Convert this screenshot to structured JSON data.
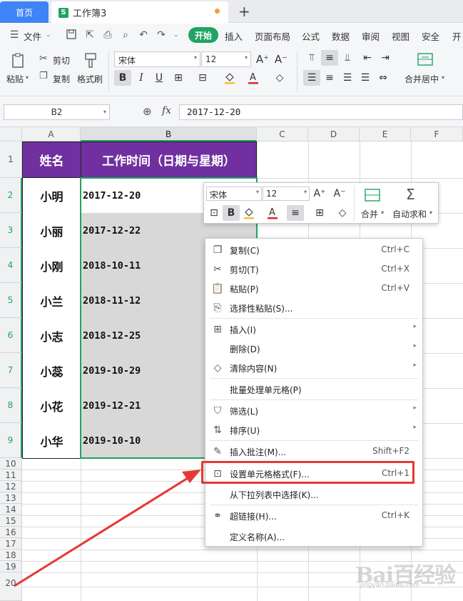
{
  "tabs": {
    "home": "首页",
    "workbook": "工作簿3",
    "add_icon": "plus-icon"
  },
  "menu": {
    "file": "文件",
    "items": [
      "开始",
      "插入",
      "页面布局",
      "公式",
      "数据",
      "审阅",
      "视图",
      "安全",
      "开"
    ]
  },
  "ribbon": {
    "paste": "粘贴",
    "cut": "剪切",
    "copy": "复制",
    "format_painter": "格式刷",
    "font_name": "宋体",
    "font_size": "12",
    "merge_center": "合并居中"
  },
  "formula_bar": {
    "cell_ref": "B2",
    "fx": "fx",
    "value": "2017-12-20"
  },
  "columns": [
    "A",
    "B",
    "C",
    "D",
    "E",
    "F"
  ],
  "rows": [
    "1",
    "2",
    "3",
    "4",
    "5",
    "6",
    "7",
    "8",
    "9",
    "10",
    "11",
    "12",
    "13",
    "14",
    "15",
    "16",
    "17",
    "18",
    "19",
    "20"
  ],
  "table": {
    "headers": [
      "姓名",
      "工作时间（日期与星期）"
    ],
    "rows": [
      [
        "小明",
        "2017-12-20"
      ],
      [
        "小丽",
        "2017-12-22"
      ],
      [
        "小刚",
        "2018-10-11"
      ],
      [
        "小兰",
        "2018-11-12"
      ],
      [
        "小志",
        "2018-12-25"
      ],
      [
        "小蕊",
        "2019-10-29"
      ],
      [
        "小花",
        "2019-12-21"
      ],
      [
        "小华",
        "2019-10-10"
      ]
    ],
    "header_color": "#7030a0"
  },
  "mini_toolbar": {
    "font_name": "宋体",
    "font_size": "12",
    "merge": "合并",
    "autosum": "自动求和"
  },
  "context_menu": [
    {
      "label": "复制(C)",
      "shortcut": "Ctrl+C",
      "icon": "copy-icon"
    },
    {
      "label": "剪切(T)",
      "shortcut": "Ctrl+X",
      "icon": "cut-icon"
    },
    {
      "label": "粘贴(P)",
      "shortcut": "Ctrl+V",
      "icon": "paste-icon"
    },
    {
      "label": "选择性粘贴(S)...",
      "shortcut": "",
      "icon": "paste-special-icon"
    },
    {
      "label": "插入(I)",
      "shortcut": "",
      "icon": "insert-icon",
      "submenu": true
    },
    {
      "label": "删除(D)",
      "shortcut": "",
      "icon": "",
      "submenu": true
    },
    {
      "label": "清除内容(N)",
      "shortcut": "",
      "icon": "eraser-icon",
      "submenu": true
    },
    {
      "label": "批量处理单元格(P)",
      "shortcut": "",
      "icon": ""
    },
    {
      "label": "筛选(L)",
      "shortcut": "",
      "icon": "filter-icon",
      "submenu": true
    },
    {
      "label": "排序(U)",
      "shortcut": "",
      "icon": "sort-icon",
      "submenu": true
    },
    {
      "label": "插入批注(M)...",
      "shortcut": "Shift+F2",
      "icon": "comment-icon"
    },
    {
      "label": "设置单元格格式(F)...",
      "shortcut": "Ctrl+1",
      "icon": "format-cells-icon"
    },
    {
      "label": "从下拉列表中选择(K)...",
      "shortcut": "",
      "icon": ""
    },
    {
      "label": "超链接(H)...",
      "shortcut": "Ctrl+K",
      "icon": "link-icon"
    },
    {
      "label": "定义名称(A)...",
      "shortcut": "",
      "icon": ""
    }
  ],
  "annotation_color": "#e53935",
  "watermark": "Bai百经验",
  "watermark_url": "jingyan.baidu.com"
}
